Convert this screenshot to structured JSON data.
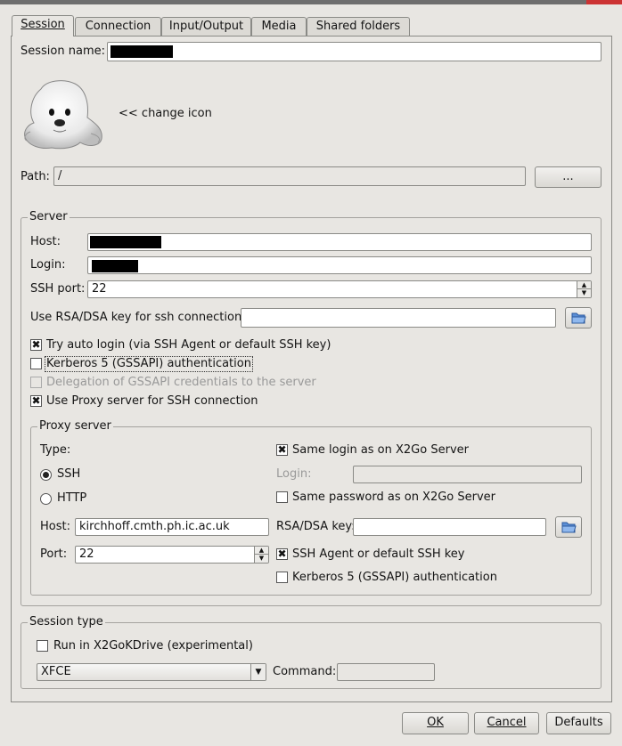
{
  "tabs": [
    {
      "label": "Session",
      "active": true
    },
    {
      "label": "Connection",
      "active": false
    },
    {
      "label": "Input/Output",
      "active": false
    },
    {
      "label": "Media",
      "active": false
    },
    {
      "label": "Shared folders",
      "active": false
    }
  ],
  "session": {
    "name_label": "Session name:",
    "change_icon_label": "<< change icon",
    "path_label": "Path:",
    "path_value": "/",
    "browse_label": "..."
  },
  "server": {
    "title": "Server",
    "host_label": "Host:",
    "login_label": "Login:",
    "ssh_port_label": "SSH port:",
    "ssh_port_value": "22",
    "rsa_label": "Use RSA/DSA key for ssh connection:",
    "rsa_value": "",
    "options": [
      {
        "label": "Try auto login (via SSH Agent or default SSH key)",
        "checked": true,
        "enabled": true
      },
      {
        "label": "Kerberos 5 (GSSAPI) authentication",
        "checked": false,
        "enabled": true
      },
      {
        "label": "Delegation of GSSAPI credentials to the server",
        "checked": false,
        "enabled": false
      },
      {
        "label": "Use Proxy server for SSH connection",
        "checked": true,
        "enabled": true
      }
    ]
  },
  "proxy": {
    "title": "Proxy server",
    "type_label": "Type:",
    "ssh_label": "SSH",
    "http_label": "HTTP",
    "selected_type": "SSH",
    "host_label": "Host:",
    "host_value": "kirchhoff.cmth.ph.ic.ac.uk",
    "port_label": "Port:",
    "port_value": "22",
    "same_login_label": "Same login as on X2Go Server",
    "same_login_checked": true,
    "login_label": "Login:",
    "same_password_label": "Same password as on X2Go Server",
    "same_password_checked": false,
    "rsa_label": "RSA/DSA key:",
    "rsa_value": "",
    "ssh_agent_label": "SSH Agent or default SSH key",
    "ssh_agent_checked": true,
    "kerberos_label": "Kerberos 5 (GSSAPI) authentication",
    "kerberos_checked": false
  },
  "session_type": {
    "title": "Session type",
    "run_label": "Run in X2GoKDrive (experimental)",
    "run_checked": false,
    "selected": "XFCE",
    "command_label": "Command:",
    "command_value": ""
  },
  "buttons": {
    "ok": "OK",
    "cancel": "Cancel",
    "defaults": "Defaults"
  }
}
